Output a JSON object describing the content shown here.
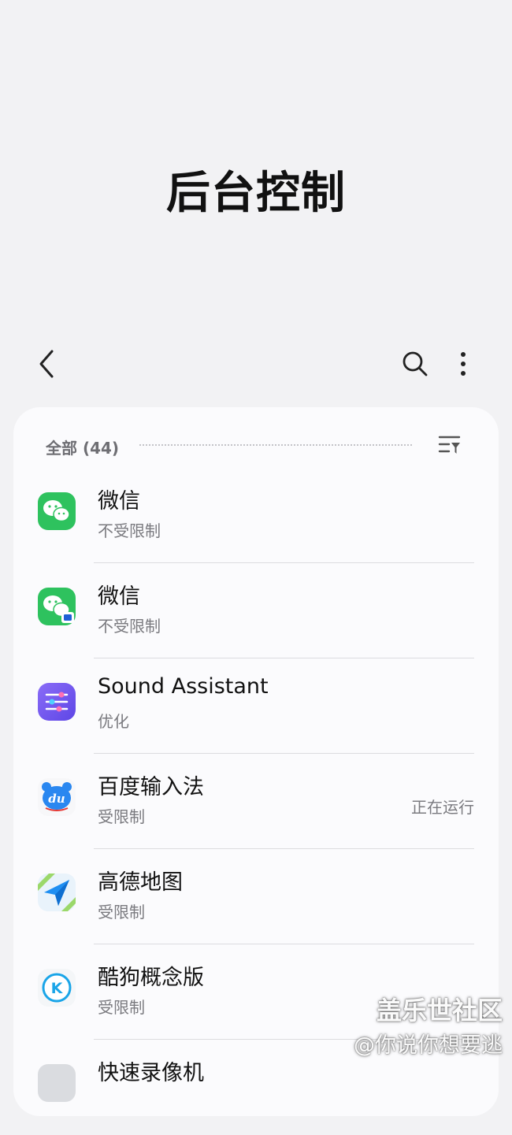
{
  "page": {
    "title": "后台控制"
  },
  "toolbar": {
    "back_icon": "chevron-left-icon",
    "search_icon": "search-icon",
    "more_icon": "more-vertical-icon"
  },
  "filter": {
    "label": "全部 (44)",
    "sort_icon": "filter-sort-icon"
  },
  "apps": [
    {
      "name": "微信",
      "status": "不受限制",
      "running": "",
      "icon": "wechat-icon",
      "color": "#2ec25e"
    },
    {
      "name": "微信",
      "status": "不受限制",
      "running": "",
      "icon": "wechat-work-profile-icon",
      "color": "#2ec25e"
    },
    {
      "name": "Sound Assistant",
      "status": "优化",
      "running": "",
      "icon": "sound-assistant-icon",
      "color": "#7a5cf0"
    },
    {
      "name": "百度输入法",
      "status": "受限制",
      "running": "正在运行",
      "icon": "baidu-input-icon",
      "color": "#2a87f0"
    },
    {
      "name": "高德地图",
      "status": "受限制",
      "running": "",
      "icon": "amap-icon",
      "color": "#1f8ff2"
    },
    {
      "name": "酷狗概念版",
      "status": "受限制",
      "running": "",
      "icon": "kugou-icon",
      "color": "#1aa5e8"
    },
    {
      "name": "快速录像机",
      "status": "",
      "running": "",
      "icon": "app-icon",
      "color": "#888888"
    }
  ],
  "watermark": {
    "line1": "盖乐世社区",
    "line2": "@你说你想要逃"
  }
}
